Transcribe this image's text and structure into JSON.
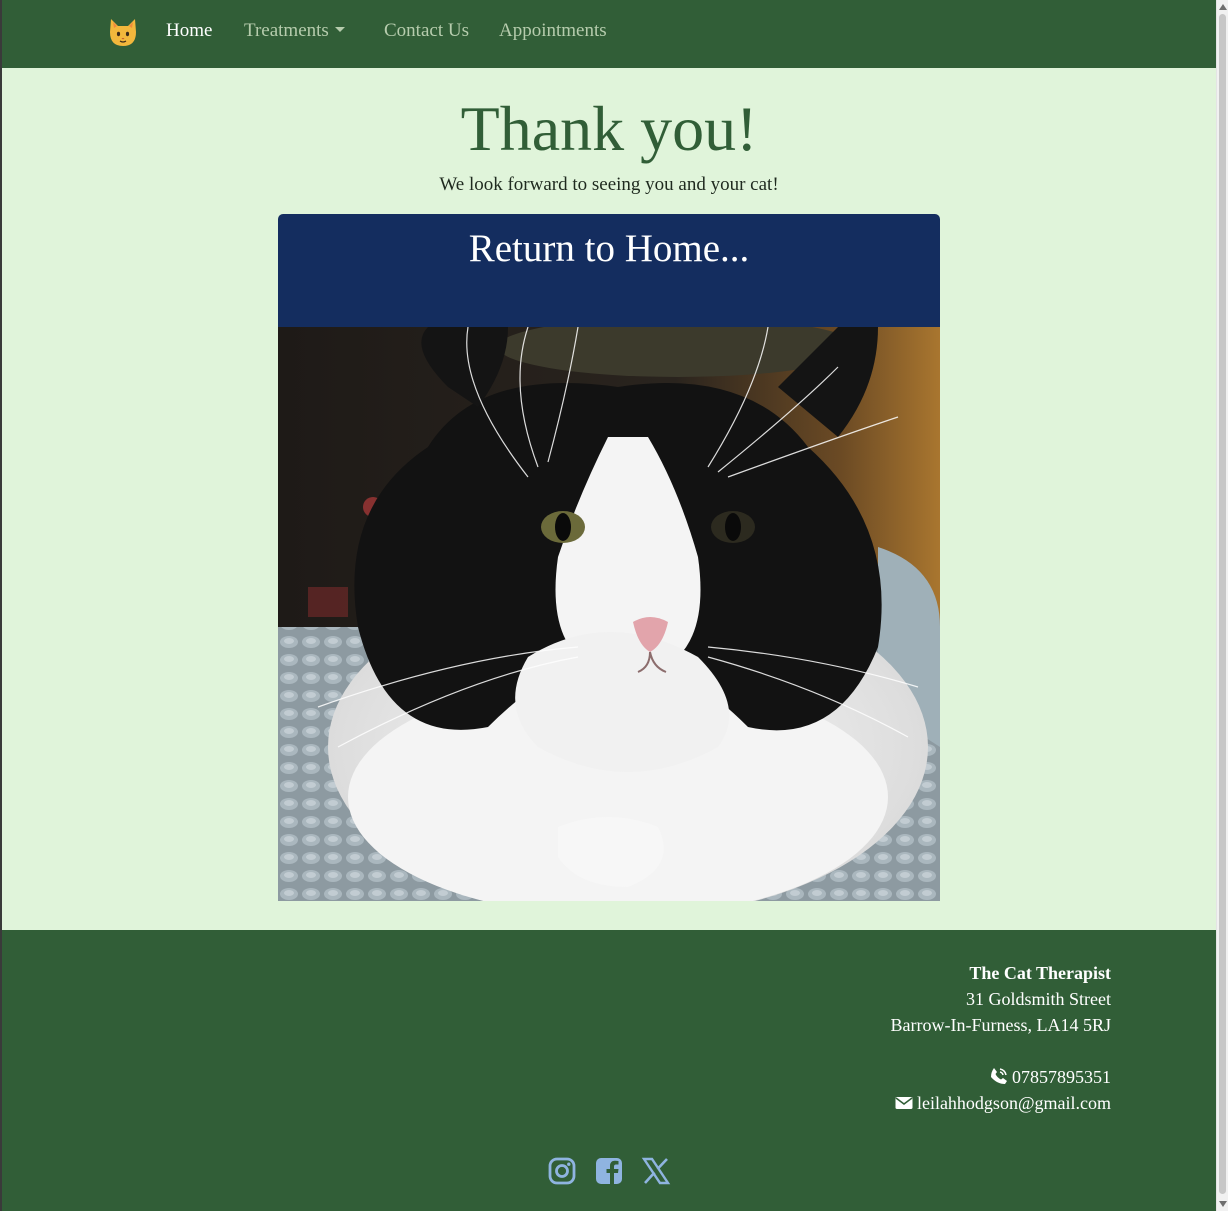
{
  "nav": {
    "brand_icon": "cat-face-icon",
    "items": [
      {
        "label": "Home",
        "active": true
      },
      {
        "label": "Treatments",
        "dropdown": true
      },
      {
        "label": "Contact Us"
      },
      {
        "label": "Appointments"
      }
    ]
  },
  "main": {
    "title": "Thank you!",
    "subtitle": "We look forward to seeing you and your cat!",
    "card": {
      "label": "Return to Home...",
      "image": "black-and-white-cat-photo"
    }
  },
  "footer": {
    "business_name": "The Cat Therapist",
    "address_line1": "31 Goldsmith Street",
    "address_line2": "Barrow-In-Furness, LA14 5RJ",
    "phone": "07857895351",
    "email": "leilahhodgson@gmail.com",
    "socials": [
      "instagram-icon",
      "facebook-icon",
      "x-twitter-icon"
    ]
  },
  "colors": {
    "nav_bg": "#315e37",
    "page_bg": "#e0f4da",
    "title_green": "#315e37",
    "card_header": "#142d5f",
    "social_icon": "#8fb4e0"
  }
}
